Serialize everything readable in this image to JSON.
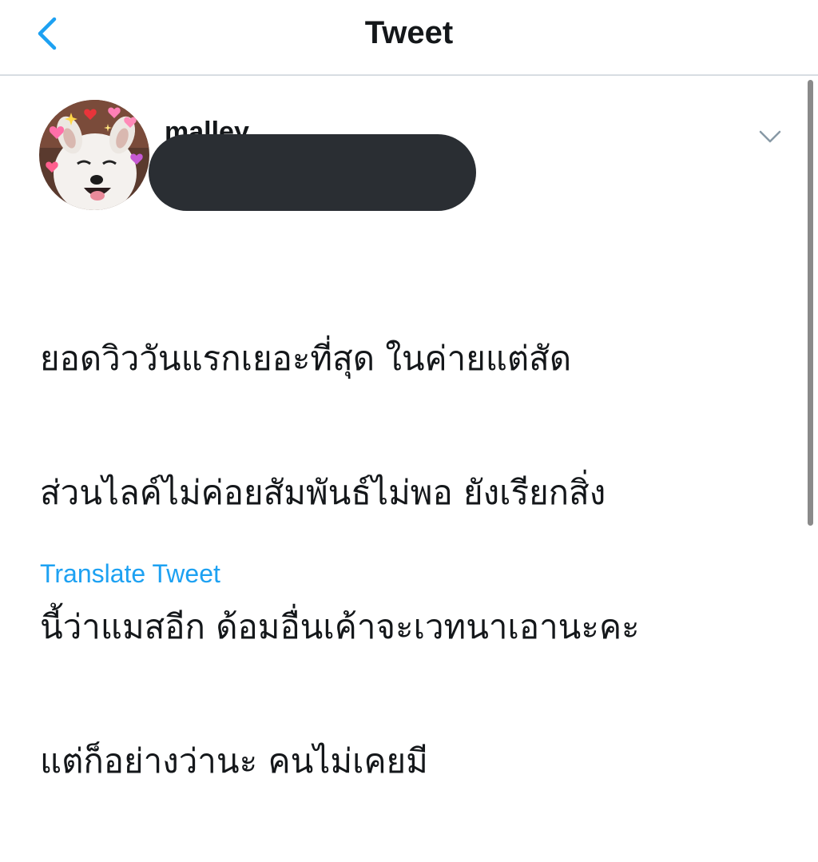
{
  "header": {
    "title": "Tweet",
    "back_icon": "chevron-left-icon",
    "accent_color": "#1da1f2"
  },
  "tweet": {
    "username_visible": "malley",
    "avatar_icon": "dog-avatar-with-hearts",
    "more_icon": "chevron-down-icon",
    "lines": [
      "ยอดวิววันแรกเยอะที่สุด ในค่ายแต่สัด",
      "ส่วนไลค์ไม่ค่อยสัมพันธ์ไม่พอ ยังเรียกสิ่ง",
      "นี้ว่าแมสอีก ด้อมอื่นเค้าจะเวทนาเอานะคะ",
      "แต่ก็อย่างว่านะ คนไม่เคยมี"
    ],
    "translate_label": "Translate Tweet"
  }
}
